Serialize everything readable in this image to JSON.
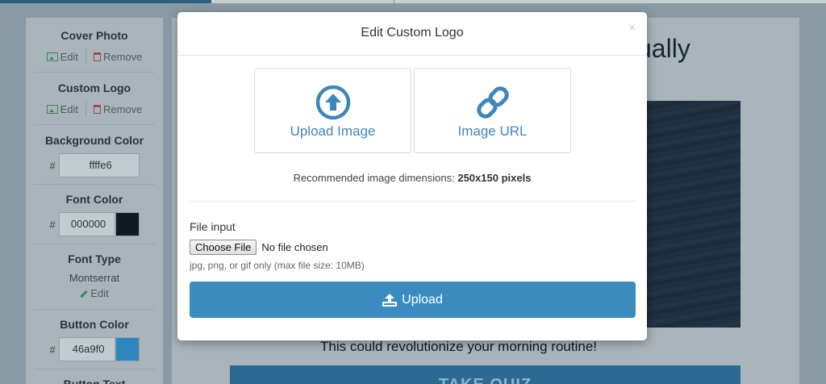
{
  "sidebar": {
    "cover_photo": {
      "title": "Cover Photo",
      "edit": "Edit",
      "remove": "Remove"
    },
    "custom_logo": {
      "title": "Custom Logo",
      "edit": "Edit",
      "remove": "Remove"
    },
    "background_color": {
      "title": "Background Color",
      "hash": "#",
      "value": "ffffe6",
      "swatch": "#c8d1cf"
    },
    "font_color": {
      "title": "Font Color",
      "hash": "#",
      "value": "000000",
      "swatch": "#0e1b25"
    },
    "font_type": {
      "title": "Font Type",
      "value": "Montserrat",
      "edit": "Edit"
    },
    "button_color": {
      "title": "Button Color",
      "hash": "#",
      "value": "46a9f0",
      "swatch": "#2f86bf"
    },
    "button_text": {
      "title": "Button Text"
    }
  },
  "canvas": {
    "headline_tail": "ually",
    "subtitle": "This could revolutionize your morning routine!",
    "quiz_button": "TAKE QUIZ"
  },
  "modal": {
    "title": "Edit Custom Logo",
    "close": "×",
    "choices": [
      {
        "label": "Upload Image",
        "icon": "upload-circle-icon"
      },
      {
        "label": "Image URL",
        "icon": "link-icon"
      }
    ],
    "recommendation_prefix": "Recommended image dimensions: ",
    "recommendation_value": "250x150 pixels",
    "file_label": "File input",
    "choose_file": "Choose File",
    "no_file": "No file chosen",
    "help": "jpg, png, or gif only (max file size: 10MB)",
    "upload_button": "Upload",
    "accent": "#3a8cc0"
  }
}
